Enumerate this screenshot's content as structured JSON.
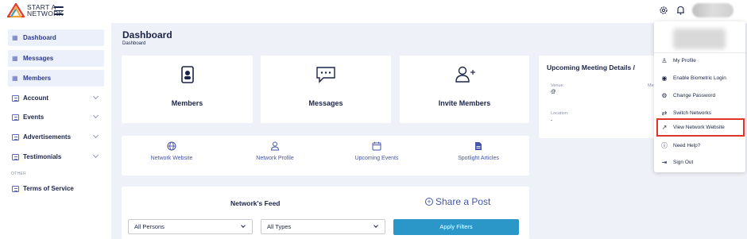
{
  "brand": {
    "line1": "START A",
    "line2": "NETWORK"
  },
  "sidebar": {
    "items": [
      {
        "label": "Dashboard",
        "icon": "grid-icon"
      },
      {
        "label": "Messages",
        "icon": "grid-icon"
      },
      {
        "label": "Members",
        "icon": "grid-icon"
      },
      {
        "label": "Account",
        "icon": "doc-icon"
      },
      {
        "label": "Events",
        "icon": "doc-icon"
      },
      {
        "label": "Advertisements",
        "icon": "doc-icon"
      },
      {
        "label": "Testimonials",
        "icon": "doc-icon"
      }
    ],
    "other_label": "OTHER",
    "terms": "Terms of Service"
  },
  "page": {
    "title": "Dashboard",
    "breadcrumb": "Dashboard"
  },
  "stats": [
    {
      "label": "Members",
      "icon": "member-card-icon"
    },
    {
      "label": "Messages",
      "icon": "message-bubble-icon"
    },
    {
      "label": "Invite Members",
      "icon": "add-user-icon"
    }
  ],
  "links": [
    {
      "label": "Network Website",
      "icon": "globe-icon"
    },
    {
      "label": "Network Profile",
      "icon": "user-icon"
    },
    {
      "label": "Upcoming Events",
      "icon": "calendar-icon"
    },
    {
      "label": "Spotlight Articles",
      "icon": "document-icon"
    }
  ],
  "meeting": {
    "title": "Upcoming Meeting Details /",
    "venue_label": "Venue:",
    "venue_value": "@",
    "location_label": "Location:",
    "location_value": "-",
    "truncated_label": "Me"
  },
  "feed": {
    "title": "Network's Feed",
    "share": "Share a Post",
    "person_filter": "All Persons",
    "type_filter": "All Types",
    "apply": "Apply Filters"
  },
  "menu": {
    "items": [
      {
        "label": "My Profile",
        "icon": "user-icon"
      },
      {
        "label": "Enable Biometric Login",
        "icon": "fingerprint-icon"
      },
      {
        "label": "Change Password",
        "icon": "gear-icon"
      },
      {
        "label": "Switch Networks",
        "icon": "switch-user-icon"
      },
      {
        "label": "View Network Website",
        "icon": "link-icon"
      },
      {
        "label": "Need Help?",
        "icon": "help-icon"
      },
      {
        "label": "Sign Out",
        "icon": "sign-out-icon"
      }
    ],
    "highlighted_index": 4
  },
  "colors": {
    "accent": "#2a97c8",
    "highlight": "#e0352b",
    "navy": "#1b2447",
    "link": "#4556a8"
  }
}
